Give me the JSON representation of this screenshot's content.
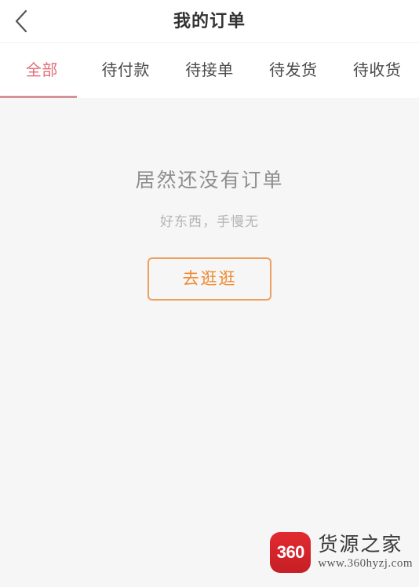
{
  "header": {
    "title": "我的订单",
    "back_icon": "chevron-left-icon"
  },
  "tabs": [
    {
      "label": "全部",
      "active": true
    },
    {
      "label": "待付款",
      "active": false
    },
    {
      "label": "待接单",
      "active": false
    },
    {
      "label": "待发货",
      "active": false
    },
    {
      "label": "待收货",
      "active": false
    }
  ],
  "empty_state": {
    "title": "居然还没有订单",
    "subtitle": "好东西，手慢无",
    "button_label": "去逛逛"
  },
  "watermark": {
    "logo_text": "360",
    "site_name": "货源之家",
    "url": "www.360hyzj.com"
  },
  "colors": {
    "accent_tab": "#e2707a",
    "tab_underline": "#d49298",
    "button_border": "#eda060",
    "button_text": "#ef8a32",
    "page_bg": "#f6f6f6",
    "header_bg": "#ffffff",
    "logo_red": "#d8121a"
  }
}
